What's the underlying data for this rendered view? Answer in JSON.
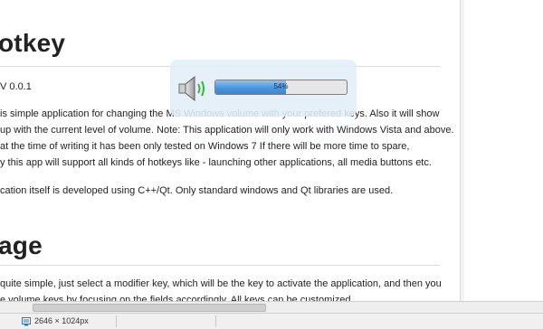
{
  "article": {
    "heading1": "otkey",
    "version": "V 0.0.1",
    "para1": [
      "is simple application for changing the MS Windows volume with your prefered keys. Also it will show",
      "up with the current level of volume. Note: This application will only work with Windows Vista and above.",
      " at the time of writing it has been only tested on Windows 7 If there will be more time to spare,",
      "y this app will support all kinds of hotkeys like - launching other applications, all media buttons etc."
    ],
    "para2": "cation itself is developed using C++/Qt. Only standard windows and Qt libraries are used.",
    "heading2": "age",
    "para3": [
      "quite simple, just select a modifier key, which will be the key to activate the application, and then you",
      "e volume keys by focusing on the fields accordingly. All keys can be customized."
    ]
  },
  "volume_osd": {
    "percent_label": "54%",
    "level": 0.54,
    "icon": "speaker-icon"
  },
  "status": {
    "dimensions": "2646 × 1024px"
  },
  "colors": {
    "progress_fill": "#4a97df",
    "osd_background": "#e1eef7"
  }
}
